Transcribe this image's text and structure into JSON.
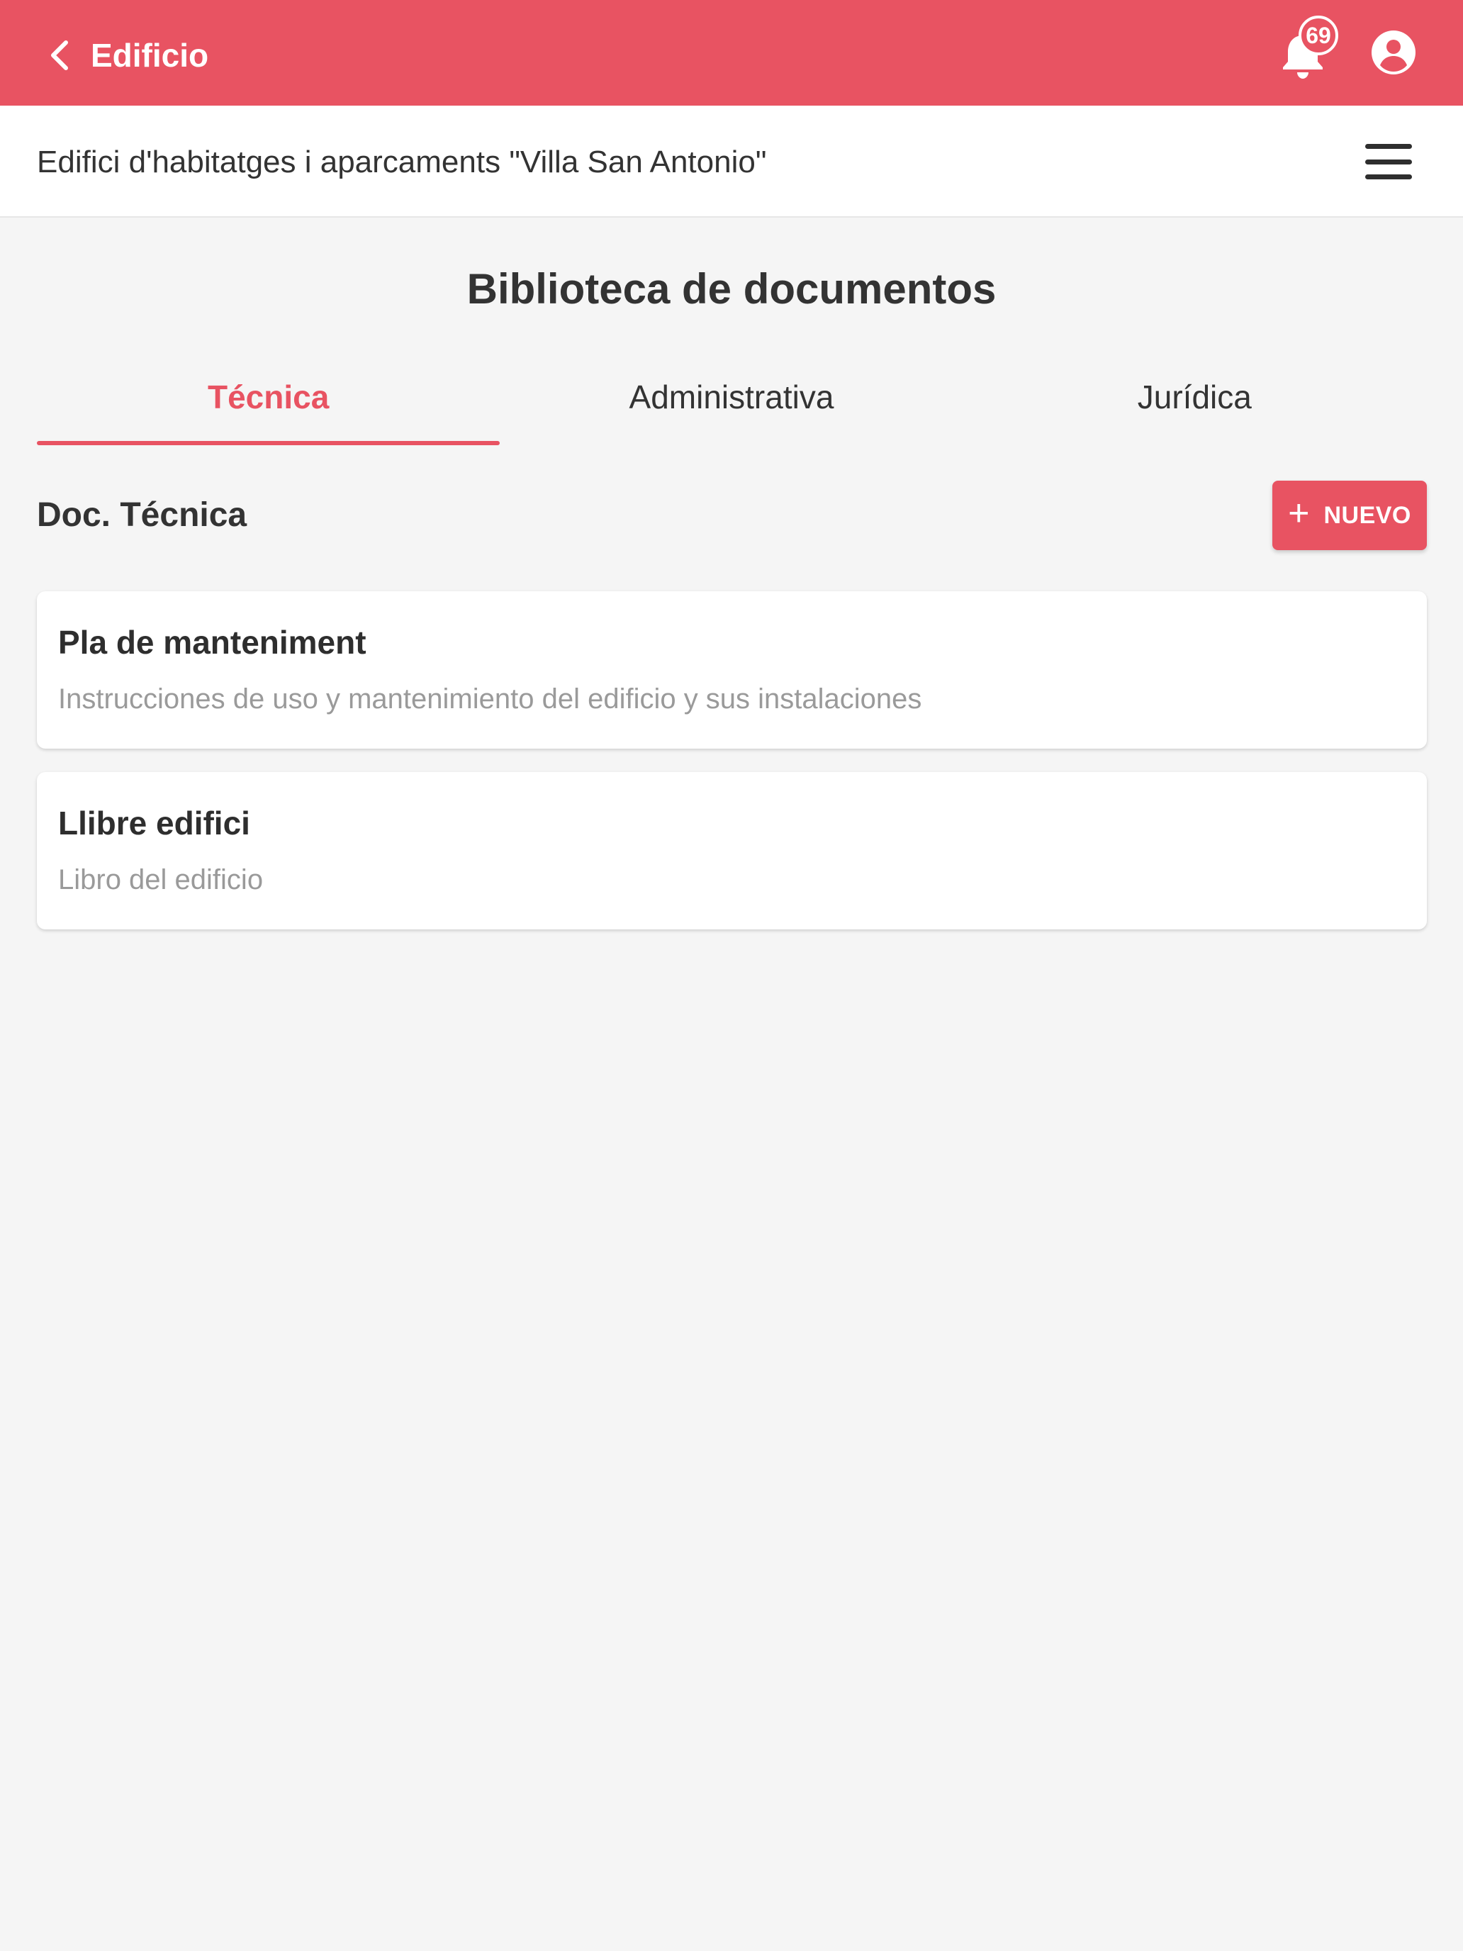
{
  "appbar": {
    "title": "Edificio",
    "notifications_count": "69",
    "color": "#e85362",
    "icons": {
      "back": "chevron-left-icon",
      "notifications": "bell-icon",
      "account": "account-circle-icon"
    }
  },
  "subheader": {
    "building_name": "Edifici d'habitatges i aparcaments \"Villa San Antonio\"",
    "menu_icon": "hamburger-menu-icon"
  },
  "page": {
    "title": "Biblioteca de documentos"
  },
  "tabs": [
    {
      "label": "Técnica",
      "active": true
    },
    {
      "label": "Administrativa",
      "active": false
    },
    {
      "label": "Jurídica",
      "active": false
    }
  ],
  "section": {
    "title": "Doc. Técnica",
    "new_button_label": "NUEVO",
    "new_button_icon": "plus-icon"
  },
  "documents": [
    {
      "title": "Pla de manteniment",
      "description": "Instrucciones de uso y mantenimiento del edificio y sus instalaciones"
    },
    {
      "title": "Llibre edifici",
      "description": "Libro del edificio"
    }
  ]
}
